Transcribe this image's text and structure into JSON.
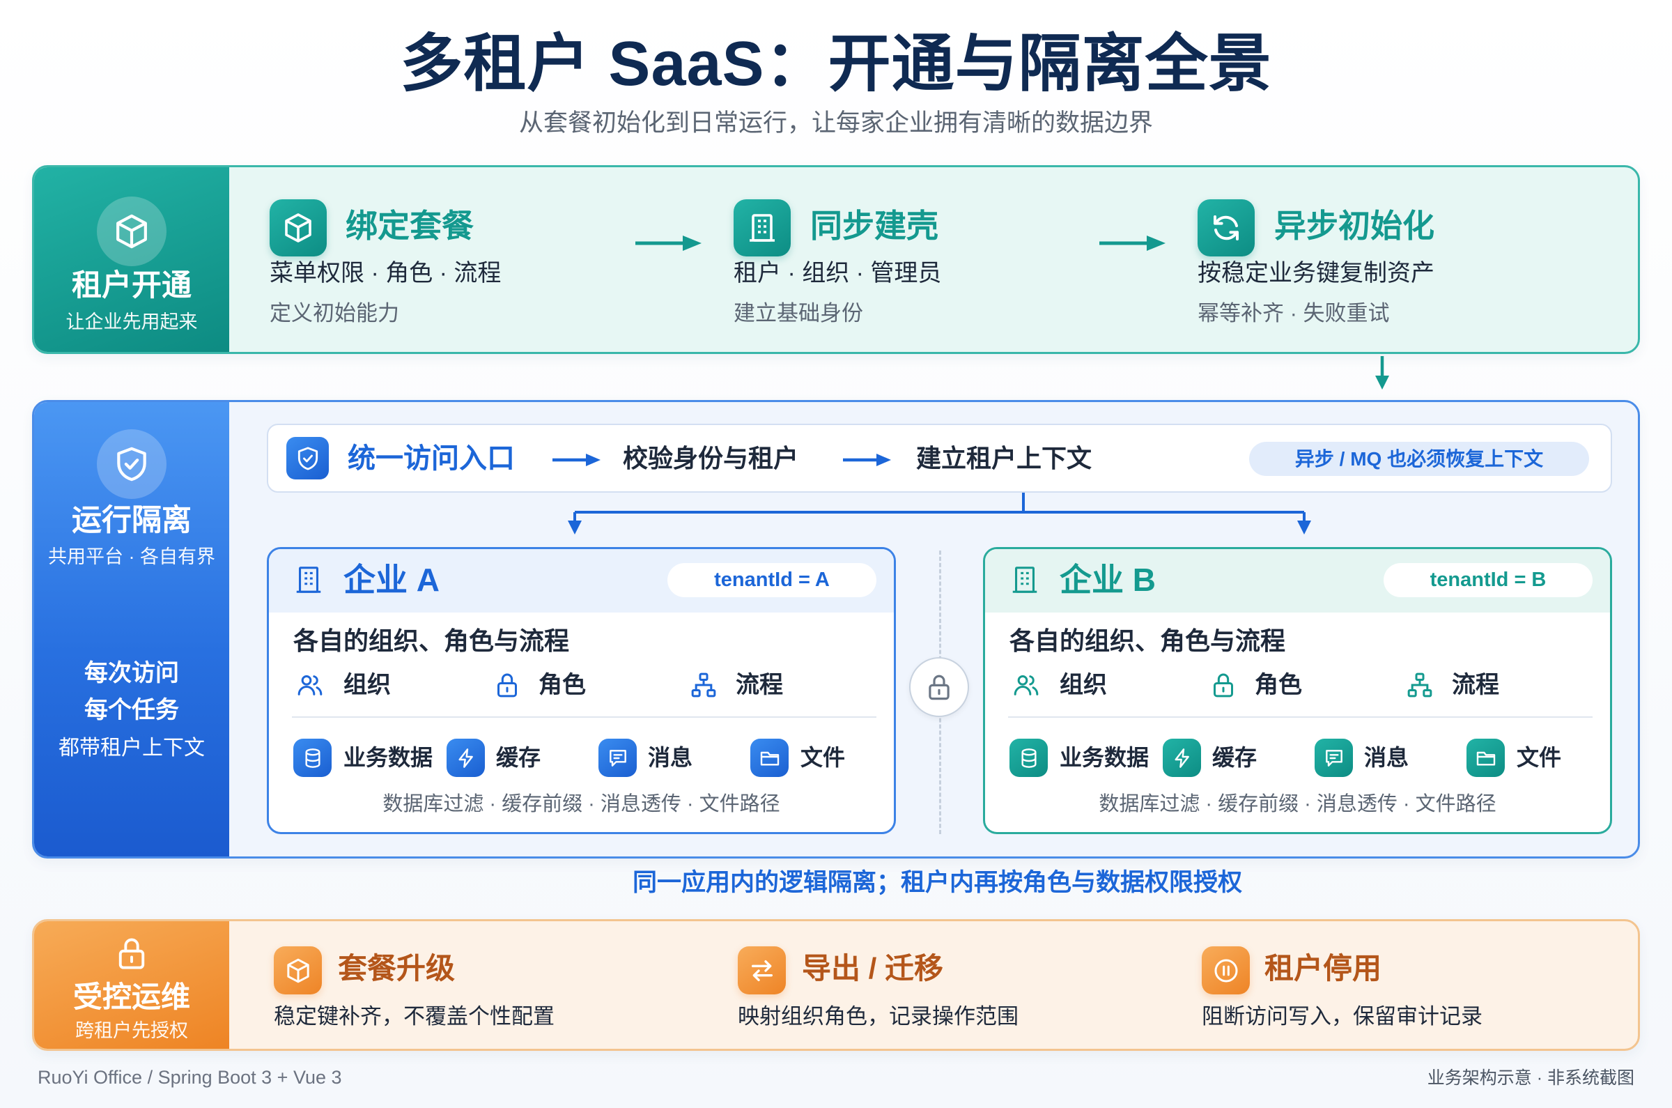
{
  "title": "多租户 SaaS：开通与隔离全景",
  "subtitle": "从套餐初始化到日常运行，让每家企业拥有清晰的数据边界",
  "colors": {
    "teal": "#14998f",
    "blue": "#1c66d8",
    "orange": "#ef8a2b",
    "brown": "#b4561a",
    "navy": "#0f2a52"
  },
  "provisioning": {
    "label": "租户开通",
    "caption": "让企业先用起来",
    "icon": "cube-icon",
    "steps": [
      {
        "icon": "cube-icon",
        "title": "绑定套餐",
        "detail": "菜单权限 · 角色 · 流程",
        "note": "定义初始能力"
      },
      {
        "icon": "building-icon",
        "title": "同步建壳",
        "detail": "租户 · 组织 · 管理员",
        "note": "建立基础身份"
      },
      {
        "icon": "refresh-icon",
        "title": "异步初始化",
        "detail": "按稳定业务键复制资产",
        "note": "幂等补齐 · 失败重试"
      }
    ]
  },
  "isolation": {
    "label": "运行隔离",
    "caption": "共用平台 · 各自有界",
    "icon": "shield-check-icon",
    "rule": {
      "line1": "每次访问",
      "line2": "每个任务",
      "caption": "都带租户上下文"
    },
    "flow": {
      "icon": "shield-check-icon",
      "steps": [
        "统一访问入口",
        "校验身份与租户",
        "建立租户上下文"
      ],
      "async_note": "异步 / MQ 也必须恢复上下文"
    },
    "tenants": [
      {
        "name": "企业 A",
        "tenant_id": "tenantId = A",
        "heading": "各自的组织、角色与流程",
        "identity": [
          {
            "icon": "users-icon",
            "label": "组织"
          },
          {
            "icon": "lock-icon",
            "label": "角色"
          },
          {
            "icon": "org-tree-icon",
            "label": "流程"
          }
        ],
        "resources": [
          {
            "icon": "database-icon",
            "label": "业务数据"
          },
          {
            "icon": "lightning-icon",
            "label": "缓存"
          },
          {
            "icon": "message-icon",
            "label": "消息"
          },
          {
            "icon": "folder-icon",
            "label": "文件"
          }
        ],
        "caption": "数据库过滤 · 缓存前缀 · 消息透传 · 文件路径"
      },
      {
        "name": "企业 B",
        "tenant_id": "tenantId = B",
        "heading": "各自的组织、角色与流程",
        "identity": [
          {
            "icon": "users-icon",
            "label": "组织"
          },
          {
            "icon": "lock-icon",
            "label": "角色"
          },
          {
            "icon": "org-tree-icon",
            "label": "流程"
          }
        ],
        "resources": [
          {
            "icon": "database-icon",
            "label": "业务数据"
          },
          {
            "icon": "lightning-icon",
            "label": "缓存"
          },
          {
            "icon": "message-icon",
            "label": "消息"
          },
          {
            "icon": "folder-icon",
            "label": "文件"
          }
        ],
        "caption": "数据库过滤 · 缓存前缀 · 消息透传 · 文件路径"
      }
    ],
    "divider_icon": "lock-icon",
    "summary": "同一应用内的逻辑隔离；租户内再按角色与数据权限授权"
  },
  "operations": {
    "label": "受控运维",
    "caption": "跨租户先授权",
    "icon": "lock-icon",
    "items": [
      {
        "icon": "cube-icon",
        "title": "套餐升级",
        "desc": "稳定键补齐，不覆盖个性配置"
      },
      {
        "icon": "swap-icon",
        "title": "导出 / 迁移",
        "desc": "映射组织角色，记录操作范围"
      },
      {
        "icon": "pause-circle-icon",
        "title": "租户停用",
        "desc": "阻断访问写入，保留审计记录"
      }
    ]
  },
  "footer": {
    "left": "RuoYi Office / Spring Boot 3 + Vue 3",
    "right": "业务架构示意 · 非系统截图"
  }
}
